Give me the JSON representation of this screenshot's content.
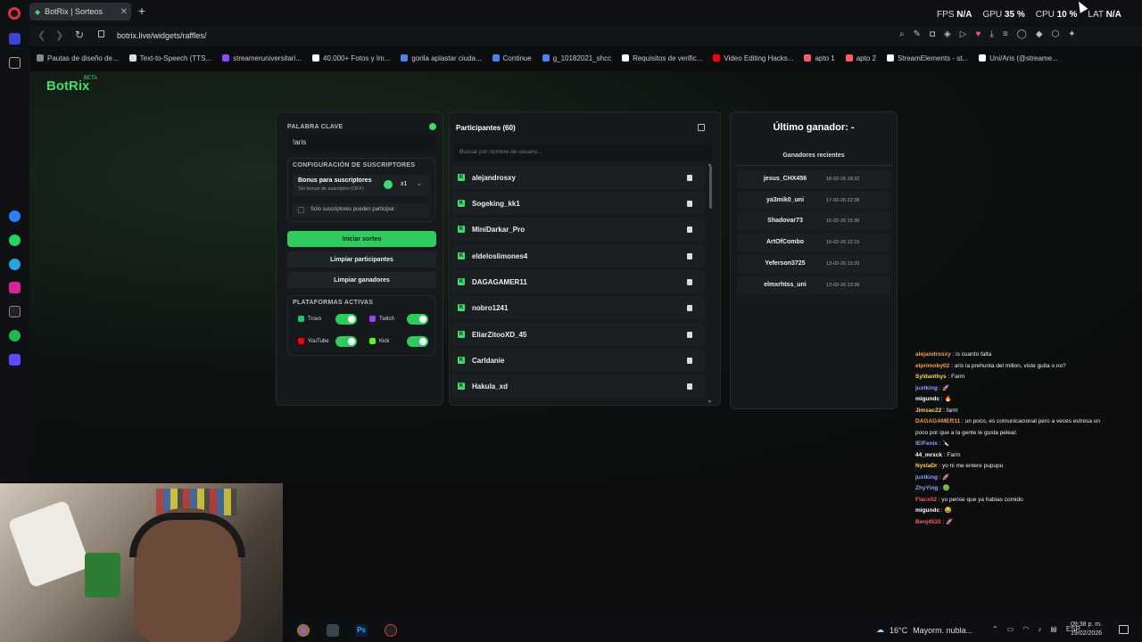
{
  "browser": {
    "tab_title": "BotRix | Sorteos",
    "url": "botrix.live/widgets/raffles/",
    "perf": {
      "fps_label": "FPS",
      "fps": "N/A",
      "gpu_label": "GPU",
      "gpu": "35 %",
      "cpu_label": "CPU",
      "cpu": "10 %",
      "lat_label": "LAT",
      "lat": "N/A"
    },
    "bookmarks": [
      {
        "label": "Pautas de diseño de...",
        "color": "#888888"
      },
      {
        "label": "Text-to-Speech (TTS...",
        "color": "#dddddd"
      },
      {
        "label": "streameruniversitari...",
        "color": "#9146ff"
      },
      {
        "label": "40.000+ Fotos y Im...",
        "color": "#ffffff"
      },
      {
        "label": "gorila aplastar ciuda...",
        "color": "#4285f4"
      },
      {
        "label": "Continue",
        "color": "#4285f4"
      },
      {
        "label": "g_10182021_shcc",
        "color": "#4285f4"
      },
      {
        "label": "Requisitos de verific...",
        "color": "#ffffff"
      },
      {
        "label": "Video Editing Hacks...",
        "color": "#ff0000"
      },
      {
        "label": "apto 1",
        "color": "#ff5a5f"
      },
      {
        "label": "apto 2",
        "color": "#ff5a5f"
      },
      {
        "label": "StreamElements - st...",
        "color": "#ffffff"
      },
      {
        "label": "Uni/Aris (@streame...",
        "color": "#ffffff"
      }
    ]
  },
  "app": {
    "logo": "BotRix",
    "logo_badge": "BETA"
  },
  "settings": {
    "keyword_label": "PALABRA CLAVE",
    "keyword_value": "!aris",
    "subs_config_label": "CONFIGURACIÓN DE SUSCRIPTORES",
    "bonus_title": "Bonus para suscriptores",
    "bonus_subtitle": "Sin bonus de suscriptor (OFF)",
    "bonus_multiplier": "x1",
    "subs_only_label": "Solo suscriptores pueden participar",
    "start_button": "Iniciar sorteo",
    "clear_participants_button": "Limpiar participantes",
    "clear_winners_button": "Limpiar ganadores",
    "platforms_label": "PLATAFORMAS ACTIVAS",
    "platforms": [
      {
        "name": "Trovo",
        "color": "#1ec96b",
        "enabled": true
      },
      {
        "name": "Twitch",
        "color": "#9146ff",
        "enabled": true
      },
      {
        "name": "YouTube",
        "color": "#ff0000",
        "enabled": true
      },
      {
        "name": "Kick",
        "color": "#53fc18",
        "enabled": true
      }
    ]
  },
  "participants": {
    "title": "Participantes (60)",
    "search_placeholder": "Buscar por nombre de usuario...",
    "list": [
      "alejandrosxy",
      "Sogeking_kk1",
      "MiniDarkar_Pro",
      "eldeloslimones4",
      "DAGAGAMER11",
      "nobro1241",
      "EliarZitooXD_45",
      "Carldanie",
      "Hakula_xd"
    ]
  },
  "winners": {
    "title": "Último ganador: -",
    "recent_label": "Ganadores recientes",
    "list": [
      {
        "name": "jesus_CHX456",
        "date": "18-02-26 18:32"
      },
      {
        "name": "ya3mik0_uni",
        "date": "17-02-26 22:38"
      },
      {
        "name": "Shadovar73",
        "date": "16-02-26 15:36"
      },
      {
        "name": "ArtOfCombo",
        "date": "16-02-26 12:15"
      },
      {
        "name": "Yeferson3725",
        "date": "13-02-26 15:20"
      },
      {
        "name": "elmxrhtss_uni",
        "date": "13-02-26 13:36"
      }
    ]
  },
  "chat": [
    {
      "user": "alejandrosxy",
      "msg": ": is cuanto falta",
      "color": "#f2a14d"
    },
    {
      "user": "elprimoby02",
      "msg": ": aris la prehunta del millon, viste guita o no?",
      "color": "#f2a14d"
    },
    {
      "user": "Syldanthys",
      "msg": ": Farm",
      "color": "#ffd24a"
    },
    {
      "user": "juxtking",
      "msg": ": 🚀",
      "color": "#8aa4ff"
    },
    {
      "user": "migundc",
      "msg": ": 🔥",
      "color": "#ffffff"
    },
    {
      "user": "Jimsac22",
      "msg": ": farm",
      "color": "#ffd24a"
    },
    {
      "user": "DAGAGAMER11",
      "msg": ": un poco, es comunicacional pero a veces estresa un",
      "color": "#f2a14d"
    },
    {
      "user": "",
      "msg": "poco por que a la gente le gusta pelear.",
      "color": "#ffffff"
    },
    {
      "user": "lElFenix",
      "msg": ": 🔪",
      "color": "#8aa4ff"
    },
    {
      "user": "44_mrxck",
      "msg": ": Farm",
      "color": "#ffffff"
    },
    {
      "user": "NyxlaDr",
      "msg": ": yo ni me entere pupupu",
      "color": "#ffd24a"
    },
    {
      "user": "juxtking",
      "msg": ": 🚀",
      "color": "#8aa4ff"
    },
    {
      "user": "ZhyYing",
      "msg": ": 🟢",
      "color": "#8aa4ff"
    },
    {
      "user": "Flacx02",
      "msg": ": yo pense que ya habias comido",
      "color": "#ff5a5f"
    },
    {
      "user": "migundc",
      "msg": ": 😂",
      "color": "#ffffff"
    },
    {
      "user": "Benj4533",
      "msg": ": 🚀",
      "color": "#ff5a5f"
    }
  ],
  "taskbar": {
    "temperature": "16°C",
    "weather": "Mayorm. nubla...",
    "lang": "ESP",
    "time": "09:38 p. m.",
    "date": "19/02/2026"
  }
}
